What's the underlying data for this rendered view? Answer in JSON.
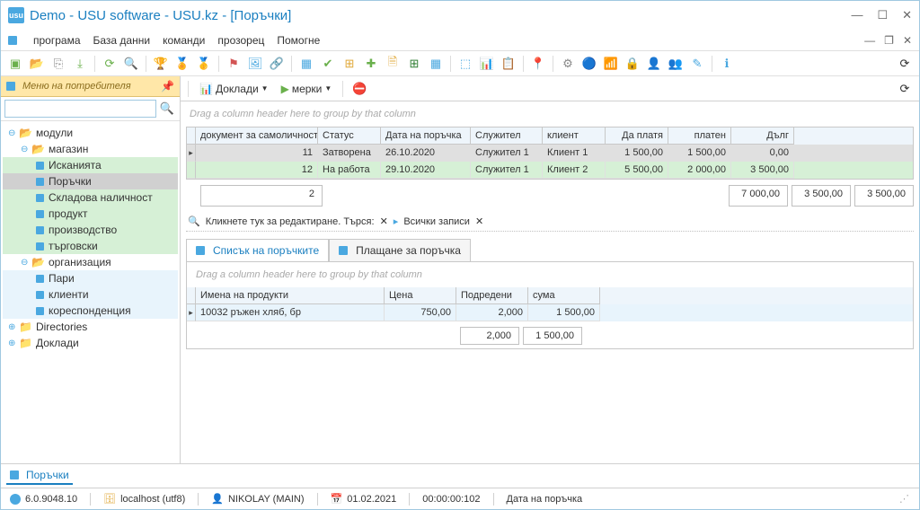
{
  "window": {
    "title": "Demo - USU software - USU.kz - [Поръчки]"
  },
  "menu": {
    "items": [
      "програма",
      "База данни",
      "команди",
      "прозорец",
      "Помогне"
    ]
  },
  "sidebar": {
    "header": "Меню на потребителя",
    "nodes": {
      "modules": "модули",
      "store": "магазин",
      "requests": "Исканията",
      "orders": "Поръчки",
      "stock": "Складова наличност",
      "product": "продукт",
      "production": "производство",
      "commercial": "търговски",
      "organization": "организация",
      "money": "Пари",
      "clients": "клиенти",
      "correspondence": "кореспонденция",
      "directories": "Directories",
      "reports": "Доклади"
    }
  },
  "toolbar2": {
    "reports": "Доклади",
    "actions": "мерки"
  },
  "grid": {
    "groupHint": "Drag a column header here to group by that column",
    "cols": [
      "документ за самоличност",
      "Статус",
      "Дата на поръчка",
      "Служител",
      "клиент",
      "Да платя",
      "платен",
      "Дълг"
    ],
    "rows": [
      {
        "id": "11",
        "status": "Затворена",
        "date": "26.10.2020",
        "emp": "Служител 1",
        "cli": "Клиент 1",
        "pay": "1 500,00",
        "paid": "1 500,00",
        "debt": "0,00"
      },
      {
        "id": "12",
        "status": "На работа",
        "date": "29.10.2020",
        "emp": "Служител 1",
        "cli": "Клиент 2",
        "pay": "5 500,00",
        "paid": "2 000,00",
        "debt": "3 500,00"
      }
    ],
    "count": "2",
    "sums": {
      "pay": "7 000,00",
      "paid": "3 500,00",
      "debt": "3 500,00"
    }
  },
  "searchbar": {
    "edit": "Кликнете тук за редактиране. Търся:",
    "all": "Всички записи"
  },
  "tabs": {
    "list": "Списък на поръчките",
    "pay": "Плащане за поръчка"
  },
  "subgrid": {
    "cols": [
      "Имена на продукти",
      "Цена",
      "Подредени",
      "сума"
    ],
    "row": {
      "name": "10032 ръжен хляб, бр",
      "price": "750,00",
      "qty": "2,000",
      "sum": "1 500,00"
    },
    "sums": {
      "qty": "2,000",
      "sum": "1 500,00"
    }
  },
  "doctab": "Поръчки",
  "status": {
    "ver": "6.0.9048.10",
    "host": "localhost (utf8)",
    "user": "NIKOLAY (MAIN)",
    "date": "01.02.2021",
    "time": "00:00:00:102",
    "field": "Дата на поръчка"
  }
}
